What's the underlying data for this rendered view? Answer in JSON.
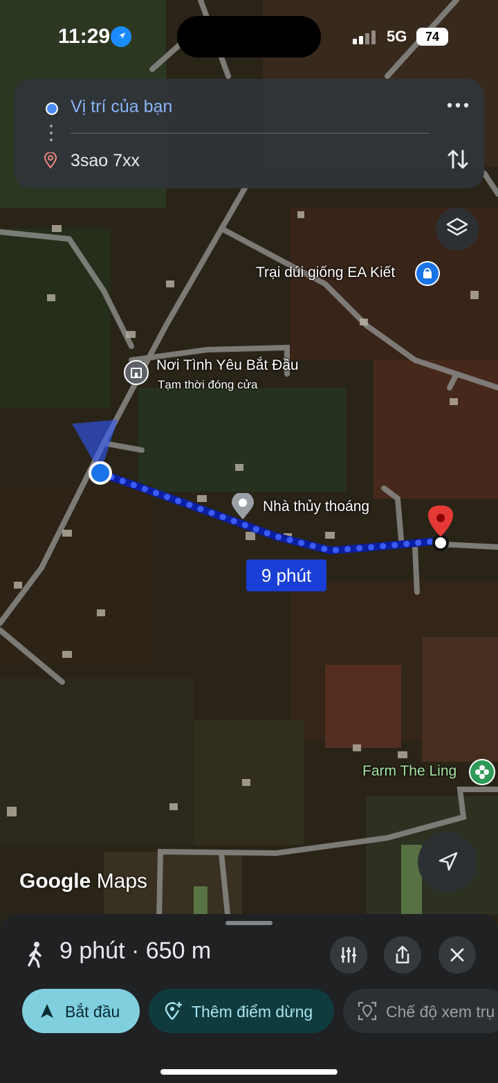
{
  "status_bar": {
    "time": "11:29",
    "network": "5G",
    "battery": "74"
  },
  "route_card": {
    "origin": "Vị trí của bạn",
    "destination": "3sao 7xx",
    "more_icon": "more-horizontal-icon",
    "swap_icon": "swap-vertical-icon"
  },
  "map": {
    "pois": [
      {
        "name": "Trại dúi giống EA Kiết"
      },
      {
        "name": "Nơi Tình Yêu Bắt Đầu",
        "status": "Tạm thời đóng cửa"
      },
      {
        "name": "Nhà thủy thoáng"
      },
      {
        "name": "Farm The Ling"
      }
    ],
    "route_eta_label": "9 phút",
    "brand": {
      "google": "Google",
      "maps": "Maps"
    },
    "colors": {
      "route": "#3b5bf5",
      "destination_pin": "#e53935",
      "user_dot": "#1a73e8"
    }
  },
  "bottom_sheet": {
    "summary": "9 phút · 650 m",
    "mode_icon": "walking-icon",
    "buttons": {
      "start": "Bắt đầu",
      "add_stop": "Thêm điểm dừng",
      "view_mode": "Chế độ xem trụ"
    },
    "accent": "#7fcfde"
  }
}
